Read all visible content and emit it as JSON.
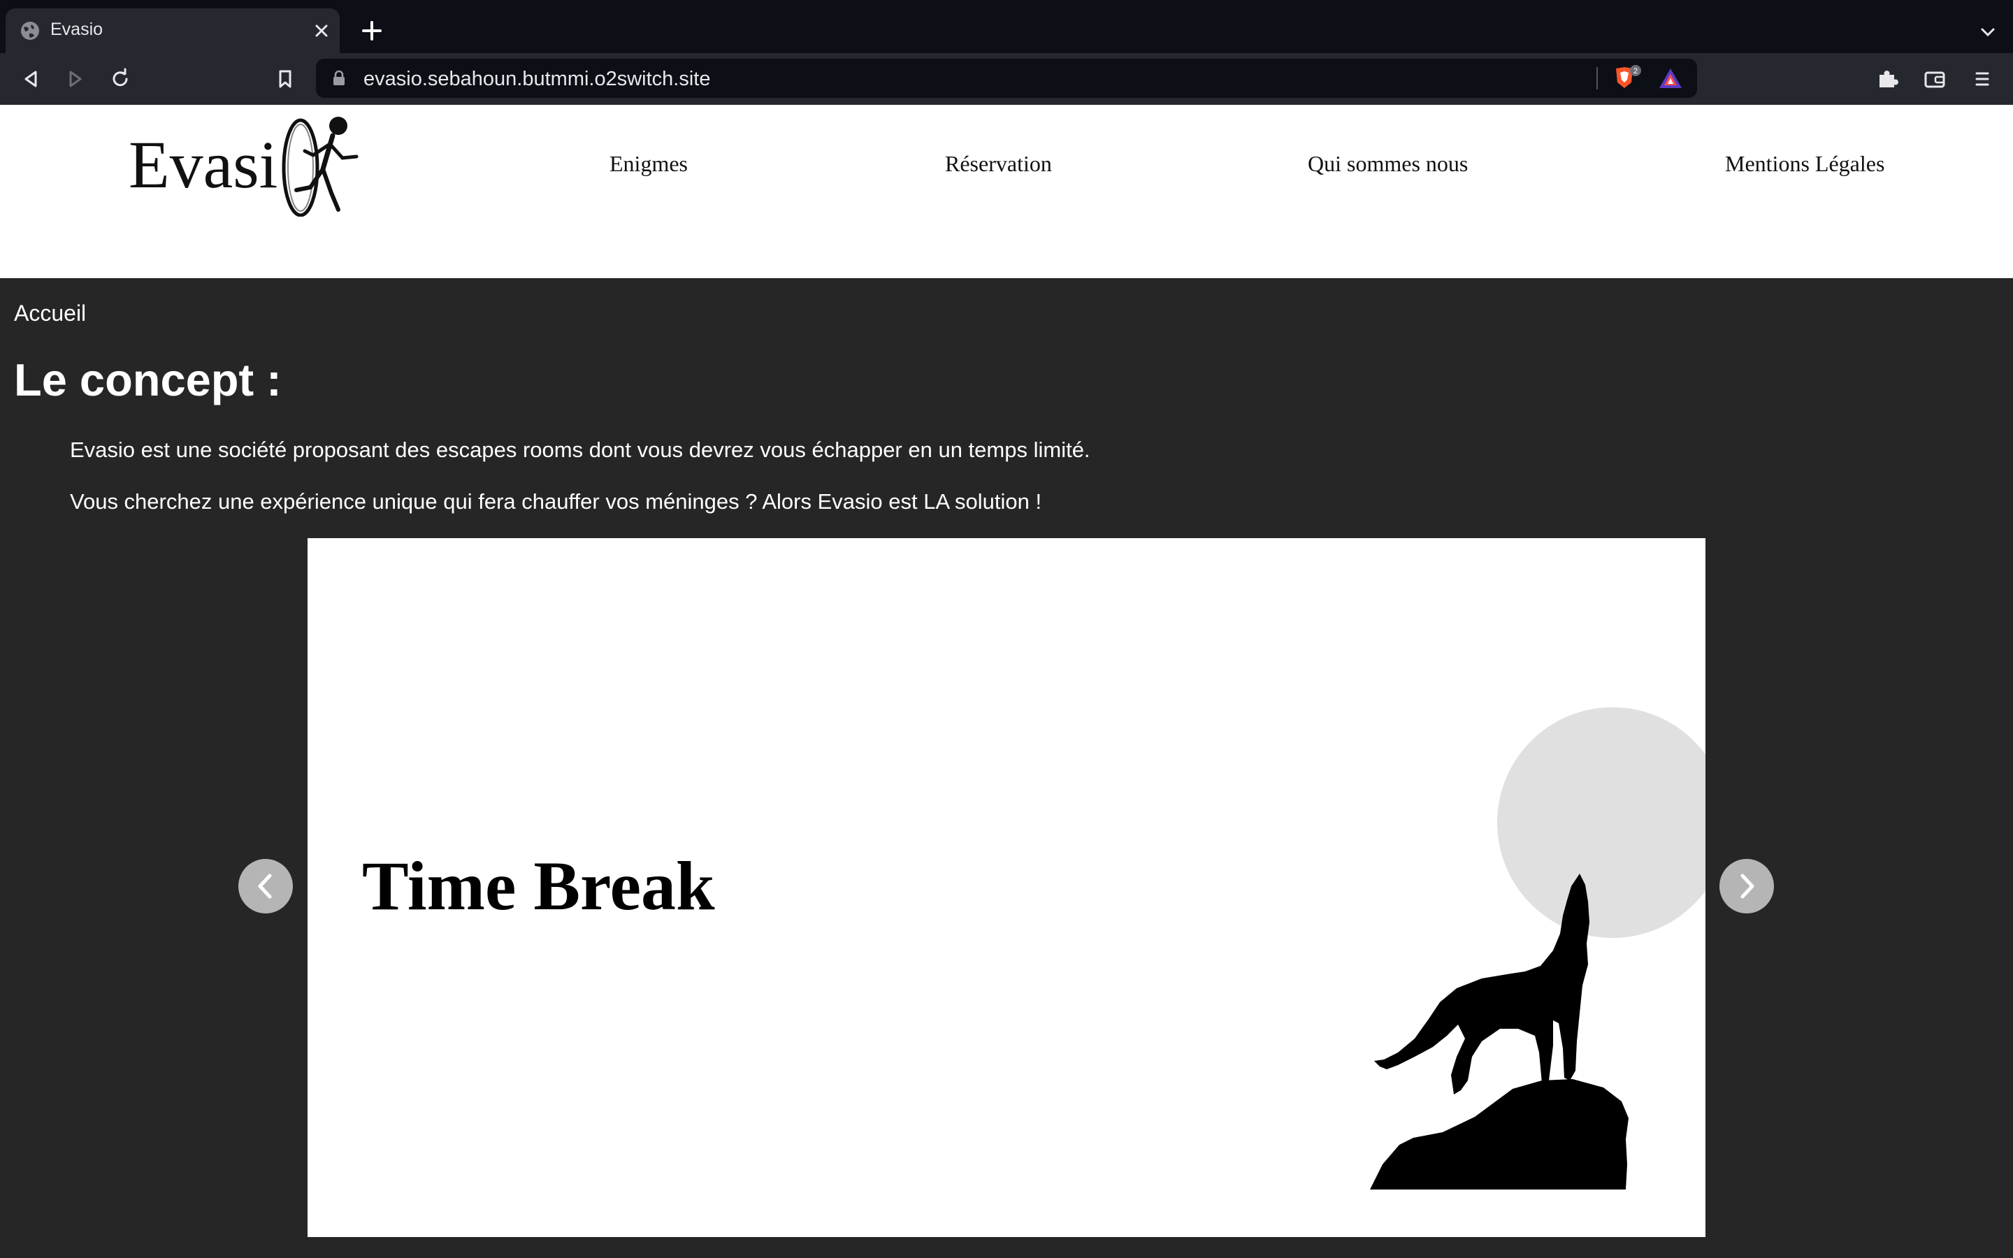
{
  "browser": {
    "tab": {
      "title": "Evasio",
      "favicon": "globe-icon",
      "close_icon": "close-icon"
    },
    "new_tab_icon": "plus-icon",
    "tabs_menu_icon": "chevron-down-icon",
    "toolbar": {
      "back_icon": "back-icon",
      "forward_icon": "forward-icon",
      "reload_icon": "reload-icon",
      "bookmark_icon": "bookmark-icon",
      "url": "evasio.sebahoun.butmmi.o2switch.site",
      "lock_icon": "lock-icon",
      "shield_badge": "2",
      "extensions_icon": "puzzle-icon",
      "wallet_icon": "wallet-icon",
      "menu_icon": "hamburger-icon"
    }
  },
  "site": {
    "logo_text": "Evasi",
    "nav": [
      "Enigmes",
      "Réservation",
      "Qui sommes nous",
      "Mentions Légales"
    ]
  },
  "main": {
    "breadcrumb": "Accueil",
    "title": "Le concept :",
    "paragraphs": [
      "Evasio est une société proposant des escapes rooms dont vous devrez vous échapper en un temps limité.",
      "Vous cherchez une expérience unique qui fera chauffer vos méninges ? Alors Evasio est LA solution !"
    ],
    "carousel": {
      "slide_title": "Time Break",
      "prev_icon": "chevron-left-icon",
      "next_icon": "chevron-right-icon"
    }
  },
  "colors": {
    "page_bg": "#262626",
    "header_bg": "#ffffff",
    "browser_dark": "#0d0f16",
    "browser_toolbar": "#262830",
    "moon": "#e0e0e0"
  }
}
